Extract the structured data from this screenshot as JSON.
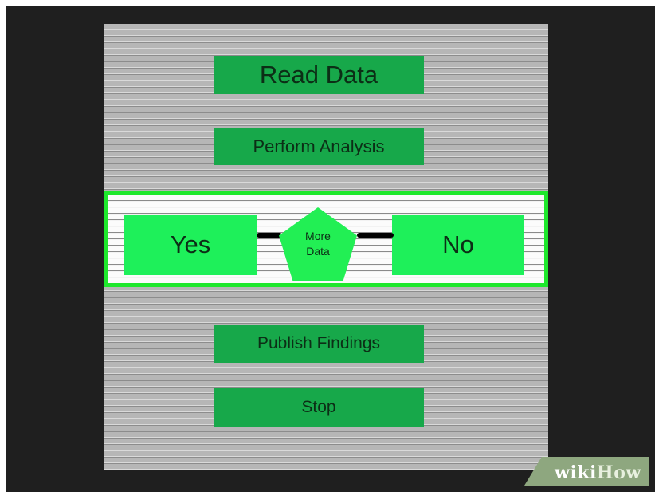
{
  "flowchart": {
    "steps": [
      {
        "id": "read",
        "label": "Read Data"
      },
      {
        "id": "analysis",
        "label": "Perform Analysis"
      },
      {
        "id": "publish",
        "label": "Publish Findings"
      },
      {
        "id": "stop",
        "label": "Stop"
      }
    ],
    "decision": {
      "line1": "More",
      "line2": "Data",
      "yes_label": "Yes",
      "no_label": "No",
      "highlight_color": "#1ee82c"
    },
    "box_color": "#17a84a",
    "choice_color": "#1ef05a"
  },
  "watermark": {
    "part1": "wiki",
    "part2": "How"
  }
}
